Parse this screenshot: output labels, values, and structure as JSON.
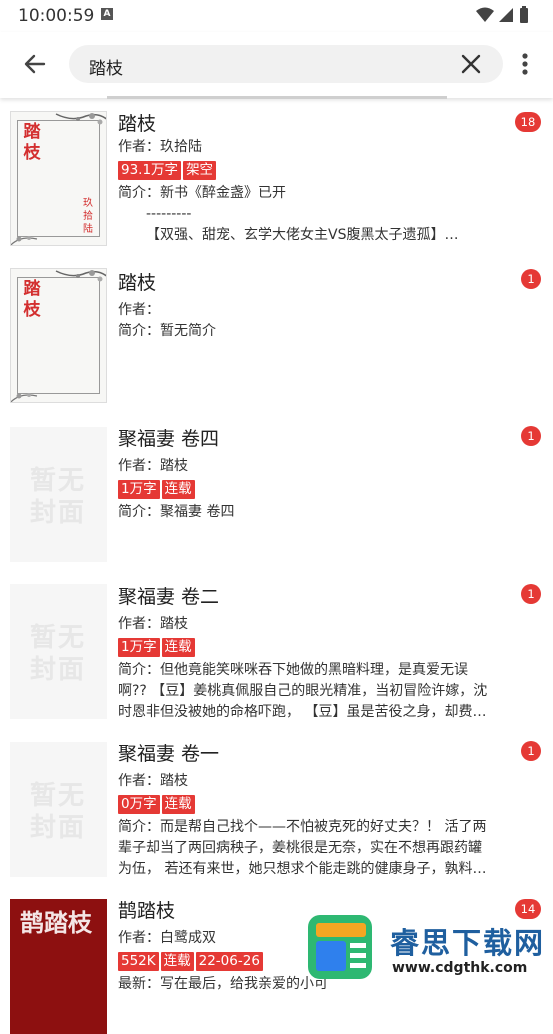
{
  "status_bar": {
    "time": "10:00:59",
    "notif_icon_letter": "A"
  },
  "search": {
    "query": "踏枝"
  },
  "results": [
    {
      "title": "踏枝",
      "author_label": "作者：",
      "author": "玖拾陆",
      "tags": [
        "93.1万字",
        "架空"
      ],
      "intro_label": "简介：",
      "intro_lines": [
        "新书《醉金盏》已开",
        "---------",
        "【双强、甜宠、玄学大佬女主VS腹黑太子遗孤】…"
      ],
      "badge": "18",
      "cover": {
        "type": "paper",
        "title": "踏枝",
        "author": "玖拾陆"
      }
    },
    {
      "title": "踏枝",
      "author_label": "作者：",
      "author": "",
      "tags": [],
      "intro_label": "简介：",
      "intro_lines": [
        "暂无简介"
      ],
      "badge": "1",
      "cover": {
        "type": "paper",
        "title": "踏枝",
        "author": ""
      }
    },
    {
      "title": "聚福妻 卷四",
      "author_label": "作者：",
      "author": "踏枝",
      "tags": [
        "1万字",
        "连载"
      ],
      "intro_label": "简介：",
      "intro_lines": [
        "聚福妻 卷四"
      ],
      "badge": "1",
      "cover": {
        "type": "none",
        "placeholder": "暂无封面"
      }
    },
    {
      "title": "聚福妻 卷二",
      "author_label": "作者：",
      "author": "踏枝",
      "tags": [
        "1万字",
        "连载"
      ],
      "intro_label": "简介：",
      "intro_lines": [
        "但他竟能笑咪咪吞下她做的黑暗料理，是真爱无误",
        "啊?? 【豆】姜桃真佩服自己的眼光精准，当初冒险许嫁，沈",
        "时恩非但没被她的命格吓跑，  【豆】虽是苦役之身，却费…"
      ],
      "badge": "1",
      "cover": {
        "type": "none",
        "placeholder": "暂无封面"
      }
    },
    {
      "title": "聚福妻 卷一",
      "author_label": "作者：",
      "author": "踏枝",
      "tags": [
        "0万字",
        "连载"
      ],
      "intro_label": "简介：",
      "intro_lines": [
        "而是帮自己找个——不怕被克死的好丈夫？！ 活了两",
        "辈子却当了两回病秧子，姜桃很是无奈，实在不想再跟药罐",
        "为伍，  若还有来世，她只想求个能走跳的健康身子，孰料…"
      ],
      "badge": "1",
      "cover": {
        "type": "none",
        "placeholder": "暂无封面"
      }
    },
    {
      "title": "鹊踏枝",
      "author_label": "作者：",
      "author": "白鹭成双",
      "tags": [
        "552K",
        "连载",
        "22-06-26"
      ],
      "intro_label": "最新：",
      "intro_lines": [
        "写在最后，给我亲爱的小可"
      ],
      "badge": "14",
      "cover": {
        "type": "red",
        "title": "鹊踏枝"
      }
    }
  ],
  "watermark": {
    "title": "睿思下载网",
    "url": "www.cdgthk.com"
  },
  "colors": {
    "accent": "#e53935",
    "search_bg": "#f1f1f1"
  }
}
